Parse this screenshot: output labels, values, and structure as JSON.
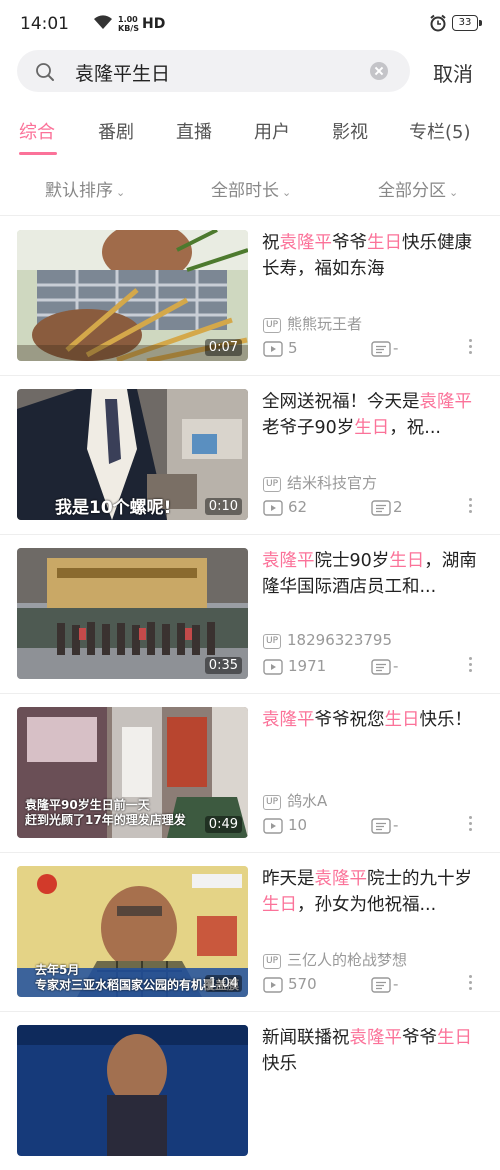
{
  "status_bar": {
    "time": "14:01",
    "speed_value": "1.00",
    "speed_unit": "KB/S",
    "hd": "HD",
    "battery": "33"
  },
  "search": {
    "query": "袁隆平生日",
    "cancel_label": "取消"
  },
  "tabs": [
    {
      "label": "综合",
      "active": true
    },
    {
      "label": "番剧"
    },
    {
      "label": "直播"
    },
    {
      "label": "用户"
    },
    {
      "label": "影视"
    },
    {
      "label": "专栏(5)"
    }
  ],
  "filters": [
    {
      "label": "默认排序"
    },
    {
      "label": "全部时长"
    },
    {
      "label": "全部分区"
    }
  ],
  "colors": {
    "accent": "#fb7299",
    "meta": "#999999"
  },
  "results": [
    {
      "title_parts": [
        [
          "祝",
          0
        ],
        [
          "袁隆平",
          1
        ],
        [
          "爷爷",
          0
        ],
        [
          "生日",
          1
        ],
        [
          "快乐健康长寿，福如东海",
          0
        ]
      ],
      "duration": "0:07",
      "uploader": "熊熊玩王者",
      "views": "5",
      "danmaku": "-",
      "caption": ""
    },
    {
      "title_parts": [
        [
          "全网送祝福！今天是",
          0
        ],
        [
          "袁隆平",
          1
        ],
        [
          "老爷子90岁",
          0
        ],
        [
          "生日",
          1
        ],
        [
          "，祝...",
          0
        ]
      ],
      "duration": "0:10",
      "uploader": "结米科技官方",
      "views": "62",
      "danmaku": "2",
      "caption": "我是10个螺呢!"
    },
    {
      "title_parts": [
        [
          "袁隆平",
          1
        ],
        [
          "院士90岁",
          0
        ],
        [
          "生日",
          1
        ],
        [
          "，湖南隆华国际酒店员工和...",
          0
        ]
      ],
      "duration": "0:35",
      "uploader": "18296323795",
      "views": "1971",
      "danmaku": "-",
      "caption": ""
    },
    {
      "title_parts": [
        [
          "袁隆平",
          1
        ],
        [
          "爷爷祝您",
          0
        ],
        [
          "生日",
          1
        ],
        [
          "快乐！",
          0
        ]
      ],
      "duration": "0:49",
      "uploader": "鸽水A",
      "views": "10",
      "danmaku": "-",
      "caption": "袁隆平90岁生日前一天\n赶到光顾了17年的理发店理发"
    },
    {
      "title_parts": [
        [
          "昨天是",
          0
        ],
        [
          "袁隆平",
          1
        ],
        [
          "院士的九十岁",
          0
        ],
        [
          "生日",
          1
        ],
        [
          "，孙女为他祝福...",
          0
        ]
      ],
      "duration": "1:04",
      "uploader": "三亿人的枪战梦想",
      "views": "570",
      "danmaku": "-",
      "caption": "去年5月\n专家对三亚水稻国家公园的有机覆盖膜"
    },
    {
      "title_parts": [
        [
          "新闻联播祝",
          0
        ],
        [
          "袁隆平",
          1
        ],
        [
          "爷爷",
          0
        ],
        [
          "生日",
          1
        ],
        [
          "快乐",
          0
        ]
      ],
      "duration": "",
      "uploader": "",
      "views": "",
      "danmaku": "",
      "caption": ""
    }
  ]
}
